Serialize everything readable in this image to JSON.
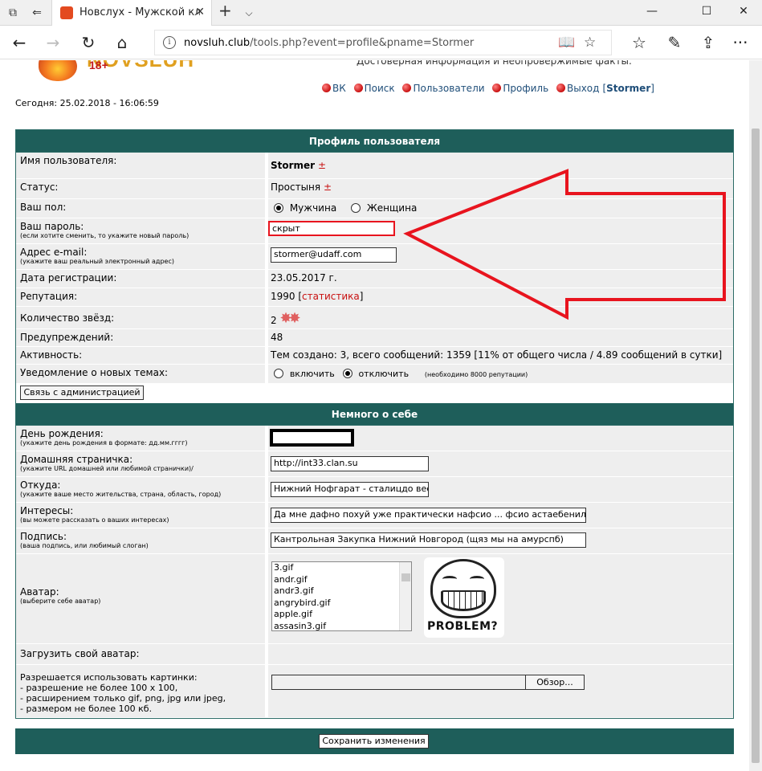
{
  "browser": {
    "tab_title": "Новслух - Мужской клуб",
    "url_host": "novsluh.club",
    "url_path": "/tools.php?event=profile&pname=Stormer"
  },
  "header": {
    "logo_text": "NOVSLUH",
    "logo_age": "18+",
    "tagline": "Достоверная информация и неопровержимые факты.",
    "date": "Сегодня: 25.02.2018 - 16:06:59",
    "nav": [
      "ВК",
      "Поиск",
      "Пользователи",
      "Профиль",
      "Выход"
    ],
    "user": "Stormer"
  },
  "profile": {
    "section_title": "Профиль пользователя",
    "username_label": "Имя пользователя:",
    "username": "Stormer",
    "pm": "±",
    "status_label": "Статус:",
    "status": "Простыня",
    "gender_label": "Ваш пол:",
    "gender_male": "Мужчина",
    "gender_female": "Женщина",
    "password_label": "Ваш пароль:",
    "password_hint": "(если хотите сменить, то укажите новый пароль)",
    "password_value": "скрыт",
    "email_label": "Адрес e-mail:",
    "email_hint": "(укажите ваш реальный электронный адрес)",
    "email_value": "stormer@udaff.com",
    "reg_label": "Дата регистрации:",
    "reg_value": "23.05.2017 г.",
    "rep_label": "Репутация:",
    "rep_value": "1990",
    "rep_link": "статистика",
    "stars_label": "Количество звёзд:",
    "stars_value": "2",
    "warn_label": "Предупреждений:",
    "warn_value": "48",
    "activity_label": "Активность:",
    "activity_value": "Тем создано: 3, всего сообщений: 1359 [11% от общего числа / 4.89 сообщений в сутки]",
    "notify_label": "Уведомление о новых темах:",
    "notify_on": "включить",
    "notify_off": "отключить",
    "notify_note": "(необходимо 8000 репутации)",
    "contact_btn": "Связь с администрацией"
  },
  "about": {
    "section_title": "Немного о себе",
    "bday_label": "День рождения:",
    "bday_hint": "(укажите день рождения в формате: дд.мм.гггг)",
    "home_label": "Домашняя страничка:",
    "home_hint": "(укажите URL домашней или любимой странички)/",
    "home_value": "http://int33.clan.su",
    "from_label": "Откуда:",
    "from_hint": "(укажите ваше место жительства, страна, область, город)",
    "from_value": "Нижний Нофгарат - сталицдо вес",
    "interests_label": "Интересы:",
    "interests_hint": "(вы можете рассказать о ваших интересах)",
    "interests_value": "Да мне дафно похуй уже практически нафсио ... фсио астаебенило",
    "sig_label": "Подпись:",
    "sig_hint": "(ваша подпись, или любимый слоган)",
    "sig_value": "Кантрольная Закупка Нижний Новгород (щяз мы на амурспб)",
    "avatar_label": "Аватар:",
    "avatar_hint": "(выберите себе аватар)",
    "avatar_options": [
      "3.gif",
      "andr.gif",
      "andr3.gif",
      "angrybird.gif",
      "apple.gif",
      "assasin3.gif"
    ],
    "avatar_caption": "PROBLEM?",
    "upload_label": "Загрузить свой аватар:",
    "upload_rules_1": "Разрешается использовать картинки:",
    "upload_rules_2": "- разрешение не более 100 x 100,",
    "upload_rules_3": "- расширением только gif, png, jpg или jpeg,",
    "upload_rules_4": "- размером не более 100 кб.",
    "browse_btn": "Обзор...",
    "save_btn": "Сохранить изменения"
  },
  "annotation": {
    "arrow_color": "#e8141e"
  }
}
